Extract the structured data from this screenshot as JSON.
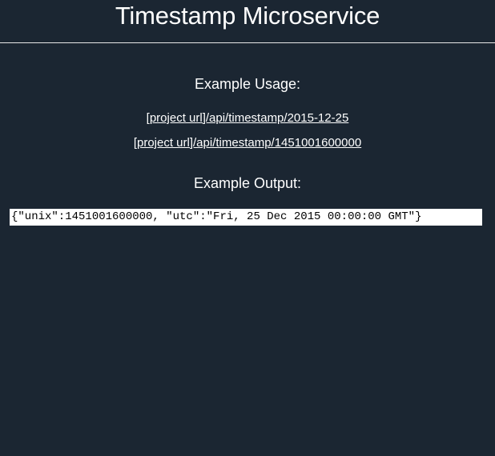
{
  "header": {
    "title": "Timestamp Microservice"
  },
  "usage": {
    "heading": "Example Usage:",
    "links": [
      "[project url]/api/timestamp/2015-12-25",
      "[project url]/api/timestamp/1451001600000"
    ]
  },
  "output": {
    "heading": "Example Output:",
    "code": "{\"unix\":1451001600000, \"utc\":\"Fri, 25 Dec 2015 00:00:00 GMT\"}"
  },
  "colors": {
    "background": "#1b2632",
    "text": "#ffffff",
    "code_background": "#ffffff",
    "code_text": "#000000"
  }
}
